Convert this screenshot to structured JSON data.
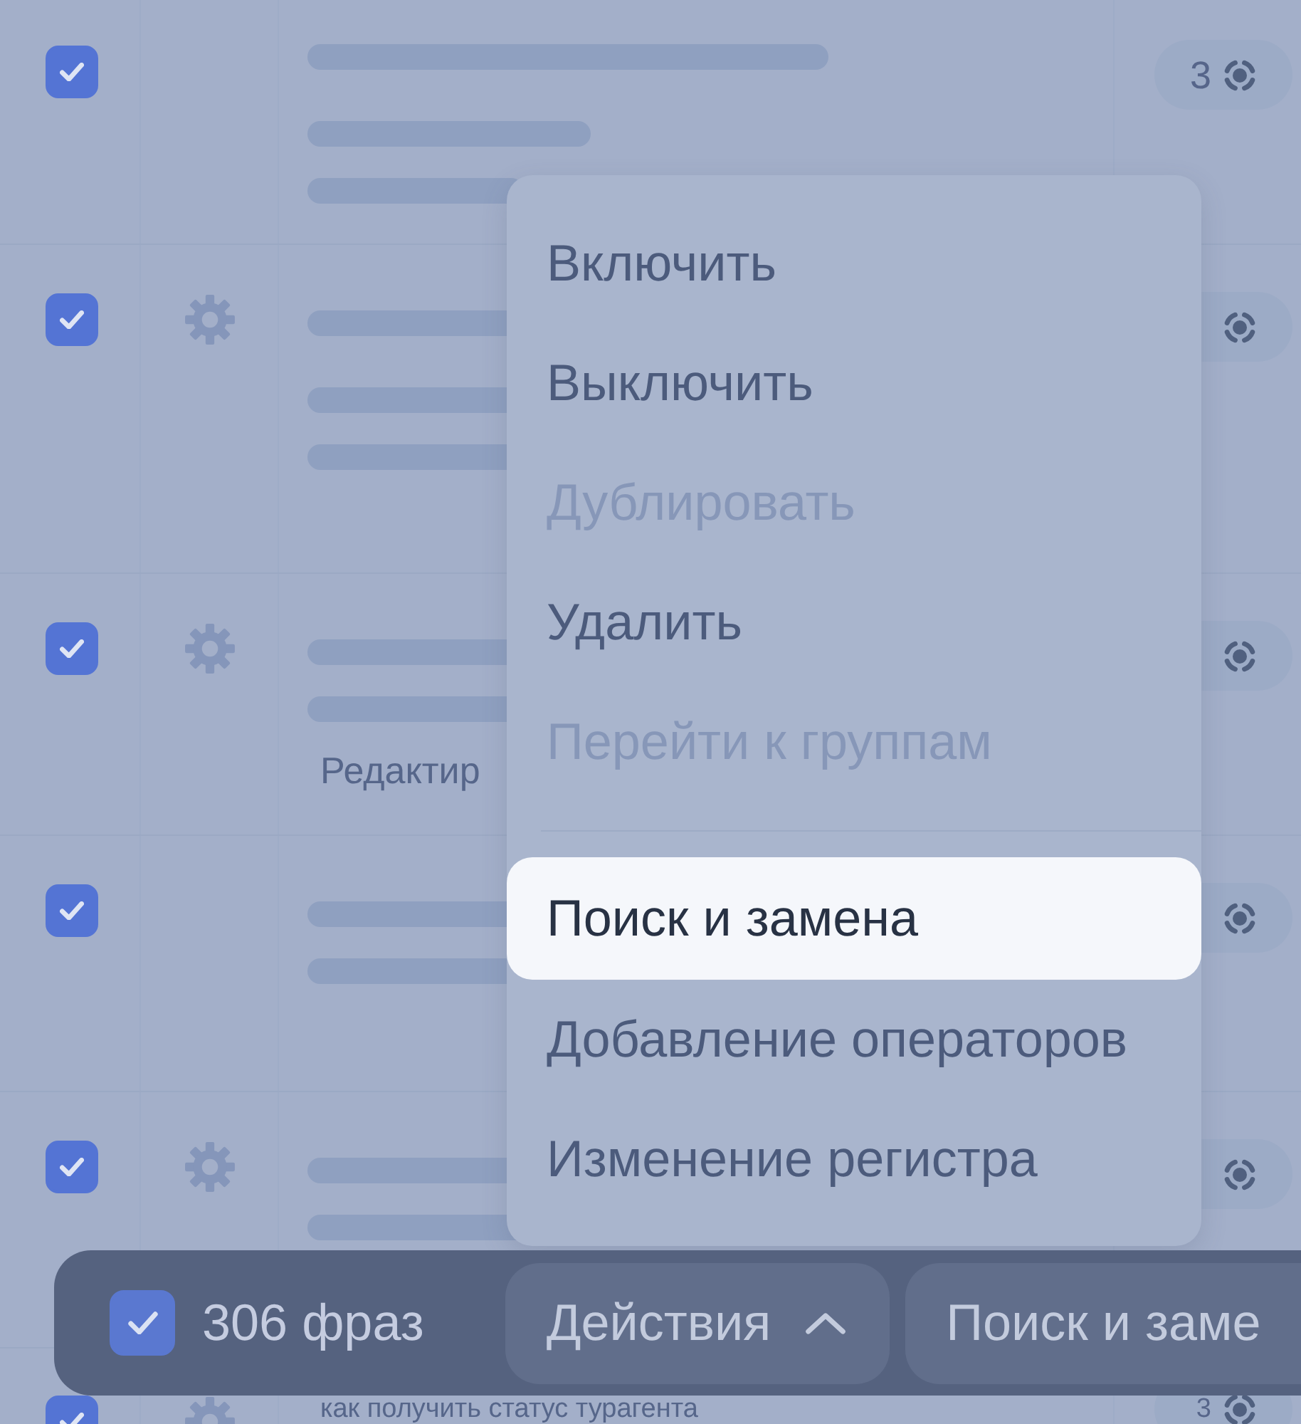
{
  "rows": [
    {
      "checked": true,
      "settings_icon": false,
      "lines": [
        {
          "kind": "long"
        },
        {
          "kind": "medium"
        },
        {
          "kind": "short"
        }
      ],
      "badge_count": "3"
    },
    {
      "checked": true,
      "settings_icon": true,
      "lines": [
        {
          "kind": "long"
        },
        {
          "kind": "long"
        },
        {
          "kind": "long"
        }
      ]
    },
    {
      "checked": true,
      "settings_icon": true,
      "lines": [
        {
          "kind": "long"
        },
        {
          "kind": "long"
        }
      ],
      "note": "Редактир"
    },
    {
      "checked": true,
      "settings_icon": false,
      "lines": [
        {
          "kind": "long"
        },
        {
          "kind": "long"
        }
      ]
    },
    {
      "checked": true,
      "settings_icon": true,
      "lines": [
        {
          "kind": "long"
        },
        {
          "kind": "long"
        }
      ]
    },
    {
      "checked": true,
      "settings_icon": true,
      "title": "как получить статус турагента",
      "badge_count": "3"
    }
  ],
  "menu": {
    "groups": [
      [
        {
          "label": "Включить",
          "disabled": false,
          "selected": false
        },
        {
          "label": "Выключить",
          "disabled": false,
          "selected": false
        },
        {
          "label": "Дублировать",
          "disabled": true,
          "selected": false
        },
        {
          "label": "Удалить",
          "disabled": false,
          "selected": false
        },
        {
          "label": "Перейти к группам",
          "disabled": true,
          "selected": false
        }
      ],
      [
        {
          "label": "Поиск и замена",
          "disabled": false,
          "selected": true
        },
        {
          "label": "Добавление операторов",
          "disabled": false,
          "selected": false
        },
        {
          "label": "Изменение регистра",
          "disabled": false,
          "selected": false
        }
      ]
    ]
  },
  "action_bar": {
    "checked": true,
    "count": "306 фраз",
    "buttons": [
      {
        "label": "Действия",
        "kind": "dropdown",
        "expanded": true
      },
      {
        "label": "Поиск и заме",
        "kind": "plain"
      }
    ]
  }
}
